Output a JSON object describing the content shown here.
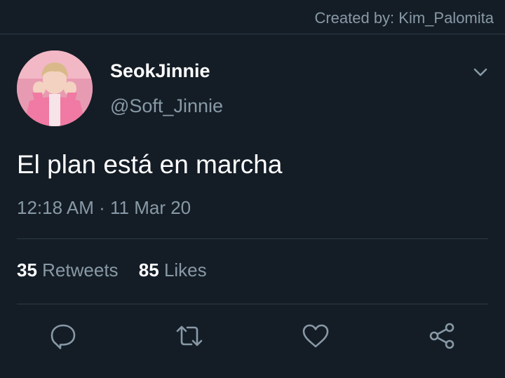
{
  "credit": "Created by: Kim_Palomita",
  "tweet": {
    "display_name": "SeokJinnie",
    "handle": "@Soft_Jinnie",
    "text": "El plan está en marcha",
    "time": "12:18 AM",
    "separator": "·",
    "date": "11 Mar 20"
  },
  "stats": {
    "retweets_count": "35",
    "retweets_label": "Retweets",
    "likes_count": "85",
    "likes_label": "Likes"
  },
  "icons": {
    "menu": "chevron-down-icon",
    "reply": "reply-icon",
    "retweet": "retweet-icon",
    "like": "heart-icon",
    "share": "share-icon"
  },
  "colors": {
    "background": "#141d26",
    "secondary_text": "#8899a6",
    "divider": "#2f3b47",
    "primary_text": "#ffffff"
  }
}
